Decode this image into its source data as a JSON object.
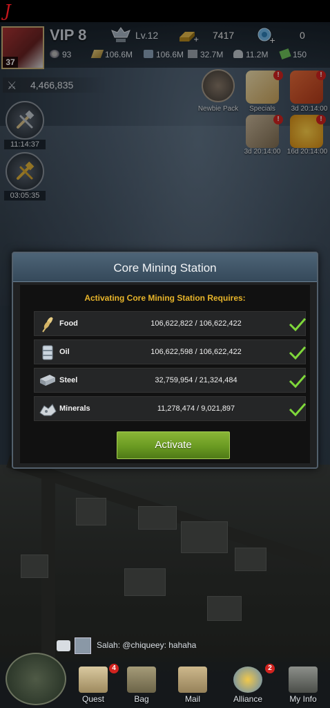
{
  "corner_mark": "J",
  "header": {
    "player_level": "37",
    "vip": "VIP 8",
    "commander_level": "Lv.12",
    "gold": "7417",
    "gems": "0"
  },
  "resources": [
    {
      "icon": "stamina-icon",
      "value": "93"
    },
    {
      "icon": "food-icon",
      "value": "106.6M"
    },
    {
      "icon": "oil-icon",
      "value": "106.6M"
    },
    {
      "icon": "steel-icon",
      "value": "32.7M"
    },
    {
      "icon": "minerals-icon",
      "value": "11.2M"
    },
    {
      "icon": "cash-icon",
      "value": "150"
    }
  ],
  "power": "4,466,835",
  "timers": [
    {
      "label": "11:14:37"
    },
    {
      "label": "03:05:35"
    }
  ],
  "events": {
    "newbie_pack": "Newbie Pack",
    "specials": "Specials",
    "event3": "3d 20:14:00",
    "event4": "3d 20:14:00",
    "event5": "16d 20:14:00"
  },
  "modal": {
    "title": "Core Mining Station",
    "heading": "Activating Core Mining Station Requires:",
    "rows": [
      {
        "name": "Food",
        "amount": "106,622,822 / 106,622,422"
      },
      {
        "name": "Oil",
        "amount": "106,622,598 / 106,622,422"
      },
      {
        "name": "Steel",
        "amount": "32,759,954 / 21,324,484"
      },
      {
        "name": "Minerals",
        "amount": "11,278,474 / 9,021,897"
      }
    ],
    "activate_label": "Activate"
  },
  "chat": {
    "message": "Salah: @chiqueey: hahaha"
  },
  "nav": {
    "quest": "Quest",
    "quest_badge": "4",
    "bag": "Bag",
    "mail": "Mail",
    "alliance": "Alliance",
    "alliance_badge": "2",
    "myinfo": "My Info"
  },
  "colors": {
    "accent_gold": "#e8b52a",
    "activate_green": "#6a9a22",
    "check_green": "#7fd83a",
    "badge_red": "#d2231f"
  }
}
